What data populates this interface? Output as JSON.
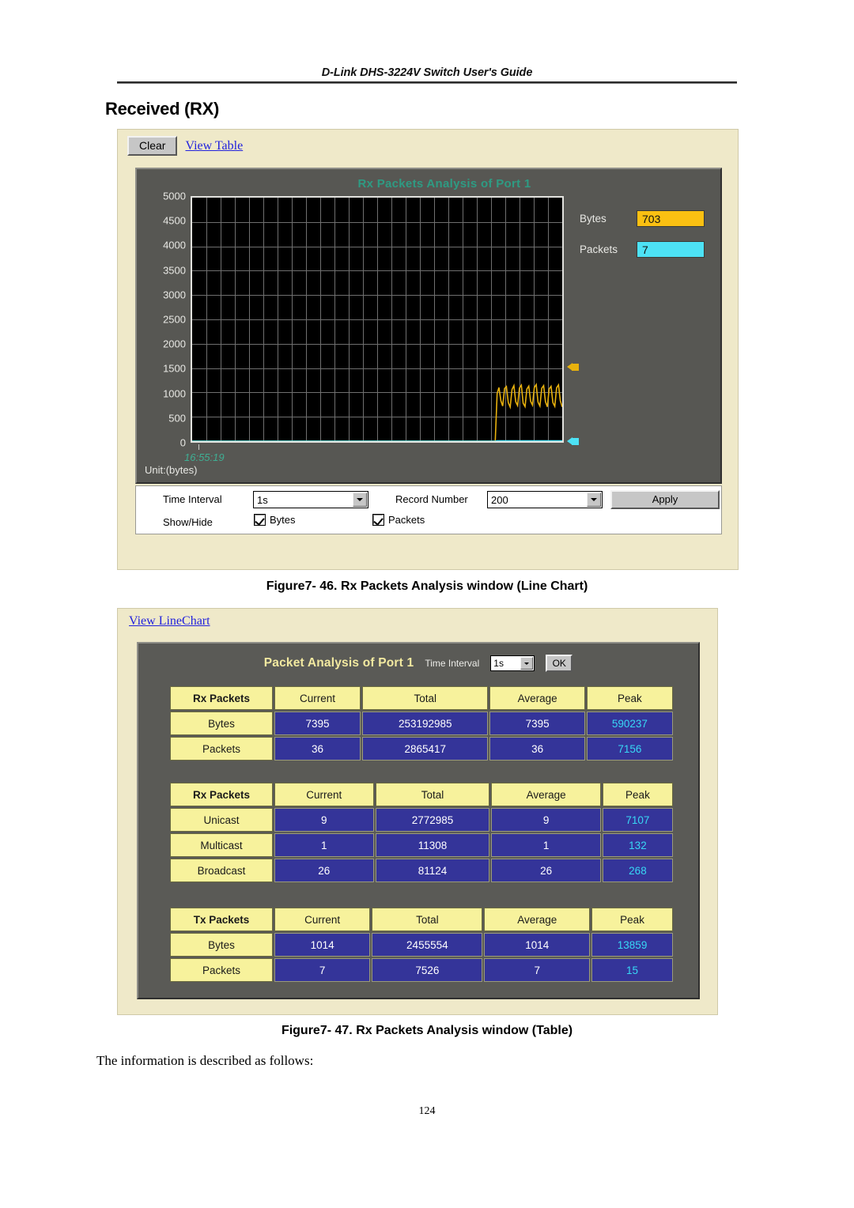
{
  "header": {
    "title": "D-Link DHS-3224V Switch User's Guide"
  },
  "page_title": "Received (RX)",
  "figure1": {
    "toolbar": {
      "clear_label": "Clear",
      "view_table_label": "View Table"
    },
    "chart_title": "Rx Packets Analysis of Port 1",
    "unit_label": "Unit:(bytes)",
    "x_axis_time": "16:55:19",
    "legend": [
      {
        "name": "Bytes",
        "value": "703",
        "color": "#fbc012"
      },
      {
        "name": "Packets",
        "value": "7",
        "color": "#4de2f5"
      }
    ],
    "controls": {
      "time_interval_label": "Time Interval",
      "time_interval_value": "1s",
      "record_number_label": "Record Number",
      "record_number_value": "200",
      "apply_label": "Apply",
      "show_hide_label": "Show/Hide",
      "checkbox_bytes_label": "Bytes",
      "checkbox_packets_label": "Packets"
    },
    "caption": "Figure7- 46.  Rx Packets Analysis window (Line Chart)"
  },
  "chart_data": {
    "type": "line",
    "title": "Rx Packets Analysis of Port 1",
    "xlabel": "",
    "ylabel": "Unit:(bytes)",
    "ylim": [
      0,
      5000
    ],
    "ytick_labels": [
      "5000",
      "4500",
      "4000",
      "3500",
      "3000",
      "2500",
      "2000",
      "1500",
      "1000",
      "500",
      "0"
    ],
    "ytick_values": [
      5000,
      4500,
      4000,
      3500,
      3000,
      2500,
      2000,
      1500,
      1000,
      500,
      0
    ],
    "xtick_labels": [
      "16:55:19"
    ],
    "grid": true,
    "legend_position": "right",
    "series": [
      {
        "name": "Bytes",
        "color": "#e8b10d",
        "current_value": 703,
        "values": [
          0,
          0,
          0,
          0,
          0,
          0,
          0,
          0,
          0,
          0,
          0,
          0,
          0,
          0,
          0,
          0,
          0,
          0,
          0,
          0,
          0,
          0,
          0,
          0,
          0,
          0,
          0,
          0,
          0,
          0,
          0,
          0,
          0,
          0,
          0,
          0,
          0,
          0,
          0,
          0,
          0,
          0,
          0,
          0,
          0,
          0,
          0,
          0,
          0,
          0,
          0,
          0,
          0,
          0,
          0,
          0,
          0,
          0,
          0,
          0,
          0,
          0,
          0,
          0,
          0,
          0,
          0,
          0,
          0,
          0,
          0,
          0,
          0,
          0,
          0,
          0,
          0,
          0,
          0,
          0,
          0,
          0,
          0,
          0,
          0,
          0,
          0,
          0,
          0,
          0,
          0,
          0,
          0,
          0,
          0,
          0,
          0,
          0,
          0,
          0,
          0,
          0,
          0,
          0,
          0,
          0,
          0,
          0,
          0,
          0,
          0,
          0,
          0,
          0,
          0,
          0,
          0,
          0,
          0,
          0,
          0,
          0,
          0,
          0,
          0,
          0,
          0,
          0,
          0,
          0,
          0,
          0,
          0,
          0,
          0,
          0,
          0,
          0,
          0,
          0,
          0,
          0,
          0,
          0,
          0,
          0,
          0,
          0,
          0,
          0,
          0,
          0,
          0,
          0,
          0,
          0,
          0,
          0,
          0,
          0,
          0,
          0,
          0,
          0,
          980,
          1100,
          830,
          720,
          1080,
          1120,
          790,
          700,
          1060,
          1140,
          810,
          730,
          1090,
          1150,
          780,
          710,
          1070,
          1130,
          820,
          740,
          1100,
          1160,
          800,
          720,
          1085,
          1140,
          810,
          705,
          1075,
          1125,
          790,
          715,
          1095,
          1155,
          830,
          703
        ],
        "visible": true
      },
      {
        "name": "Packets",
        "color": "#4de2f5",
        "current_value": 7,
        "values": [
          0,
          0,
          0,
          0,
          0,
          0,
          0,
          0,
          0,
          0,
          0,
          0,
          0,
          0,
          0,
          0,
          0,
          0,
          0,
          0,
          0,
          0,
          0,
          0,
          0,
          0,
          0,
          0,
          0,
          0,
          0,
          0,
          0,
          0,
          0,
          0,
          0,
          0,
          0,
          0,
          0,
          0,
          0,
          0,
          0,
          0,
          0,
          0,
          0,
          0,
          0,
          0,
          0,
          0,
          0,
          0,
          0,
          0,
          0,
          0,
          0,
          0,
          0,
          0,
          0,
          0,
          0,
          0,
          0,
          0,
          0,
          0,
          0,
          0,
          0,
          0,
          0,
          0,
          0,
          0,
          0,
          0,
          0,
          0,
          0,
          0,
          0,
          0,
          0,
          0,
          0,
          0,
          0,
          0,
          0,
          0,
          0,
          0,
          0,
          0,
          0,
          0,
          0,
          0,
          0,
          0,
          0,
          0,
          0,
          0,
          0,
          0,
          0,
          0,
          0,
          0,
          0,
          0,
          0,
          0,
          0,
          0,
          0,
          0,
          0,
          0,
          0,
          0,
          0,
          0,
          0,
          0,
          0,
          0,
          0,
          0,
          0,
          0,
          0,
          0,
          0,
          0,
          0,
          0,
          0,
          0,
          0,
          0,
          0,
          0,
          0,
          0,
          0,
          0,
          0,
          0,
          0,
          0,
          0,
          0,
          0,
          0,
          0,
          0,
          7,
          7,
          7,
          7,
          7,
          7,
          7,
          7,
          7,
          7,
          7,
          7,
          7,
          7,
          7,
          7,
          7,
          7,
          7,
          7,
          7,
          7,
          7,
          7,
          7,
          7,
          7,
          7,
          7,
          7,
          7,
          7,
          7,
          7,
          7,
          7
        ],
        "visible": true
      }
    ]
  },
  "figure2": {
    "view_linechart_label": "View LineChart",
    "panel_title": "Packet Analysis of Port 1",
    "time_interval_label": "Time Interval",
    "time_interval_value": "1s",
    "ok_label": "OK",
    "tables": [
      {
        "columns": [
          "Rx Packets",
          "Current",
          "Total",
          "Average",
          "Peak"
        ],
        "rows": [
          {
            "label": "Bytes",
            "current": "7395",
            "total": "253192985",
            "average": "7395",
            "peak": "590237"
          },
          {
            "label": "Packets",
            "current": "36",
            "total": "2865417",
            "average": "36",
            "peak": "7156"
          }
        ]
      },
      {
        "columns": [
          "Rx Packets",
          "Current",
          "Total",
          "Average",
          "Peak"
        ],
        "rows": [
          {
            "label": "Unicast",
            "current": "9",
            "total": "2772985",
            "average": "9",
            "peak": "7107"
          },
          {
            "label": "Multicast",
            "current": "1",
            "total": "11308",
            "average": "1",
            "peak": "132"
          },
          {
            "label": "Broadcast",
            "current": "26",
            "total": "81124",
            "average": "26",
            "peak": "268"
          }
        ]
      },
      {
        "columns": [
          "Tx Packets",
          "Current",
          "Total",
          "Average",
          "Peak"
        ],
        "rows": [
          {
            "label": "Bytes",
            "current": "1014",
            "total": "2455554",
            "average": "1014",
            "peak": "13859"
          },
          {
            "label": "Packets",
            "current": "7",
            "total": "7526",
            "average": "7",
            "peak": "15"
          }
        ]
      }
    ],
    "caption": "Figure7- 47.  Rx Packets Analysis window (Table)"
  },
  "body_text": "The information is described as follows:",
  "page_number": "124"
}
